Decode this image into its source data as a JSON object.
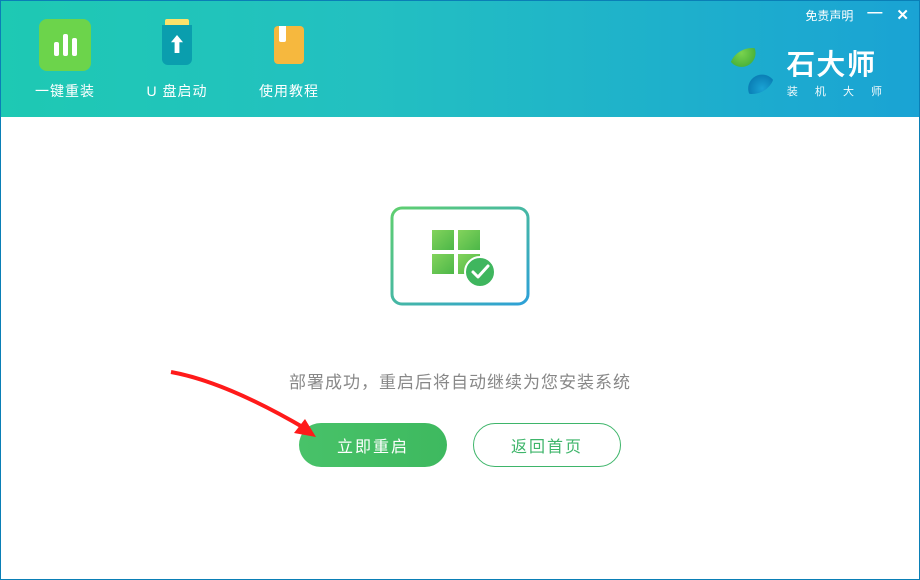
{
  "header": {
    "tabs": [
      {
        "label": "一键重装"
      },
      {
        "label": "U 盘启动"
      },
      {
        "label": "使用教程"
      }
    ],
    "disclaimer": "免责声明"
  },
  "brand": {
    "title": "石大师",
    "subtitle": "装 机 大 师"
  },
  "content": {
    "status_message": "部署成功，重启后将自动继续为您安装系统",
    "primary_button": "立即重启",
    "secondary_button": "返回首页"
  }
}
